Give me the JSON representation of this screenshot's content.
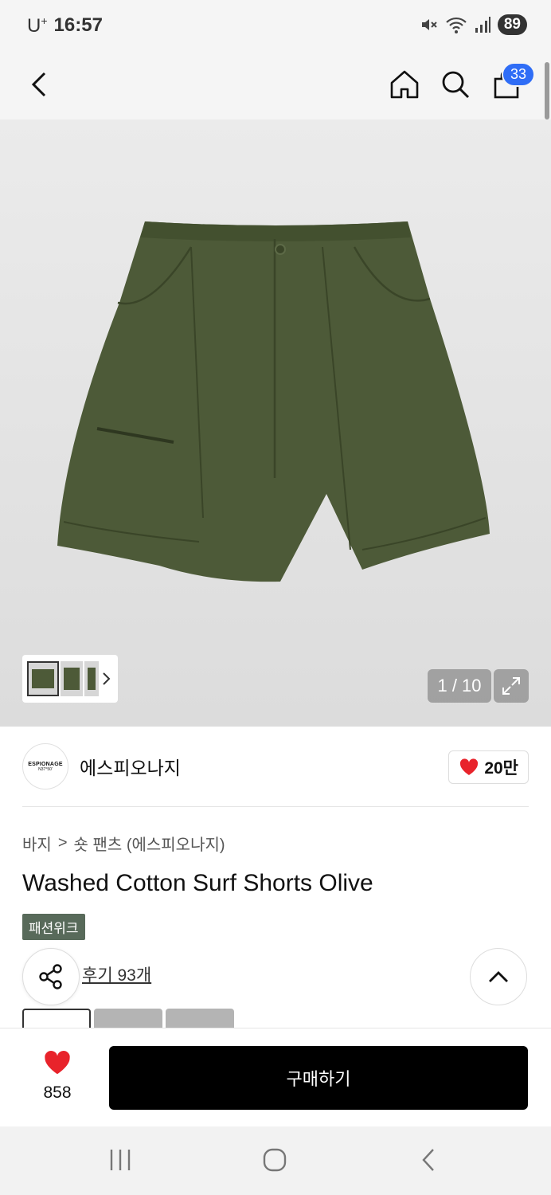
{
  "status_bar": {
    "carrier": "U",
    "carrier_sup": "+",
    "time": "16:57",
    "battery": "89"
  },
  "header": {
    "cart_count": "33"
  },
  "gallery": {
    "counter": "1 / 10"
  },
  "brand": {
    "logo_line1": "ESPIONAGE",
    "logo_line2": "N37°50'",
    "name": "에스피오나지",
    "likes": "20만"
  },
  "breadcrumb": {
    "category": "바지",
    "separator": ">",
    "subcategory": "숏 팬츠 (에스피오나지)"
  },
  "product": {
    "title": "Washed Cotton Surf Shorts Olive",
    "tag": "패션위크",
    "reviews": "후기 93개"
  },
  "bottom_bar": {
    "wish_count": "858",
    "buy_label": "구매하기"
  },
  "colors": {
    "like_red": "#e8232b",
    "badge_blue": "#2f6df6",
    "tag_green": "#586a5a",
    "product_olive": "#4d5a38"
  }
}
